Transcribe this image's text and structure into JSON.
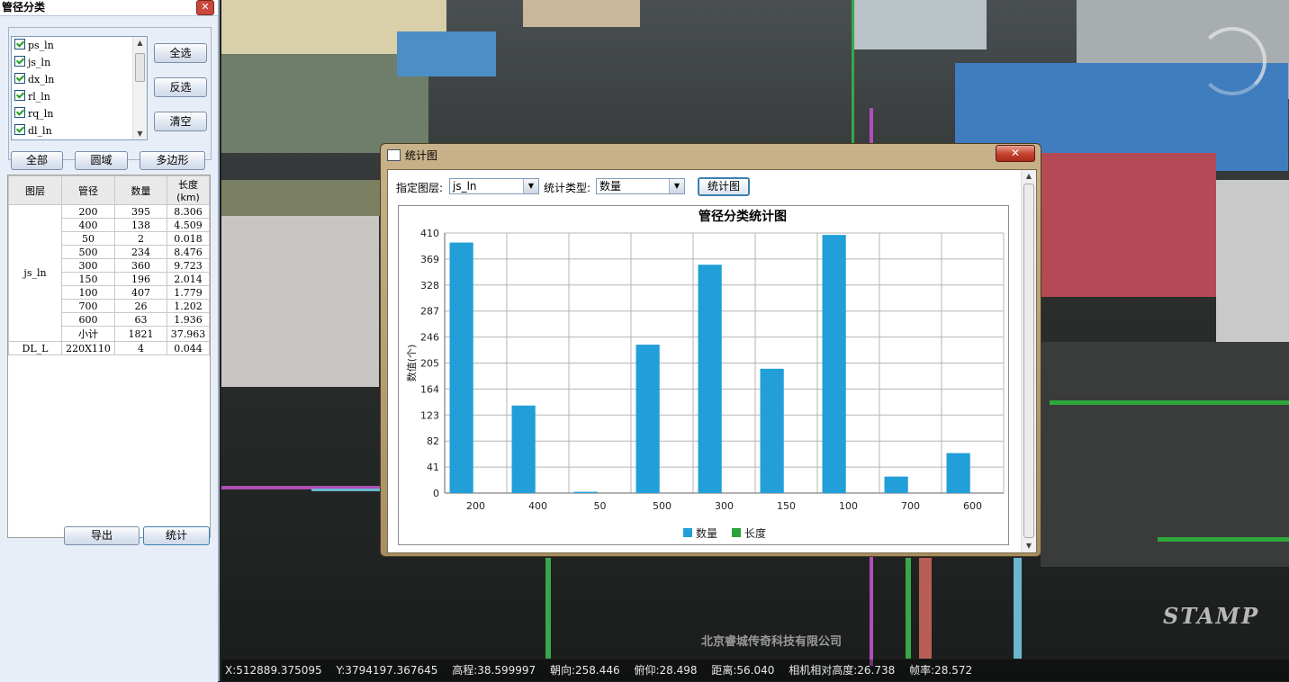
{
  "left_panel": {
    "title": "管径分类",
    "close_glyph": "✕",
    "layers": [
      "ps_ln",
      "js_ln",
      "dx_ln",
      "rl_ln",
      "rq_ln",
      "dl_ln"
    ],
    "buttons": {
      "select_all": "全选",
      "invert": "反选",
      "clear": "清空"
    },
    "mode_buttons": {
      "all": "全部",
      "circle": "圆域",
      "polygon": "多边形"
    },
    "table": {
      "headers": [
        "图层",
        "管径",
        "数量",
        "长度(km)"
      ],
      "group1_layer": "js_ln",
      "group1_rows": [
        [
          "200",
          "395",
          "8.306"
        ],
        [
          "400",
          "138",
          "4.509"
        ],
        [
          "50",
          "2",
          "0.018"
        ],
        [
          "500",
          "234",
          "8.476"
        ],
        [
          "300",
          "360",
          "9.723"
        ],
        [
          "150",
          "196",
          "2.014"
        ],
        [
          "100",
          "407",
          "1.779"
        ],
        [
          "700",
          "26",
          "1.202"
        ],
        [
          "600",
          "63",
          "1.936"
        ],
        [
          "小计",
          "1821",
          "37.963"
        ]
      ],
      "group2_row": [
        "DL_L",
        "220X110",
        "4",
        "0.044"
      ]
    },
    "bottom_buttons": {
      "export": "导出",
      "stats": "统计"
    }
  },
  "dialog": {
    "title": "统计图",
    "close_glyph": "✕",
    "layer_label": "指定图层:",
    "layer_value": "js_ln",
    "type_label": "统计类型:",
    "type_value": "数量",
    "chart_button": "统计图"
  },
  "chart_data": {
    "type": "bar",
    "title": "管径分类统计图",
    "ylabel": "数值(个)",
    "xlabel": "",
    "categories": [
      "200",
      "400",
      "50",
      "500",
      "300",
      "150",
      "100",
      "700",
      "600"
    ],
    "series": [
      {
        "name": "数量",
        "color": "#229ed8",
        "values": [
          395,
          138,
          2,
          234,
          360,
          196,
          407,
          26,
          63
        ]
      },
      {
        "name": "长度",
        "color": "#2aa33a",
        "values": []
      }
    ],
    "yticks": [
      0,
      41,
      82,
      123,
      164,
      205,
      246,
      287,
      328,
      369,
      410
    ],
    "ylim": [
      0,
      410
    ],
    "grid": true,
    "legend": "bottom"
  },
  "status_bar": {
    "x": "X:512889.375095",
    "y": "Y:3794197.367645",
    "elevation": "高程:38.599997",
    "heading": "朝向:258.446",
    "pitch": "俯仰:28.498",
    "distance": "距离:56.040",
    "camera_height": "相机相对高度:26.738",
    "fps": "帧率:28.572"
  },
  "scene": {
    "watermark": "北京睿城传奇科技有限公司",
    "logo": "STAMP"
  }
}
